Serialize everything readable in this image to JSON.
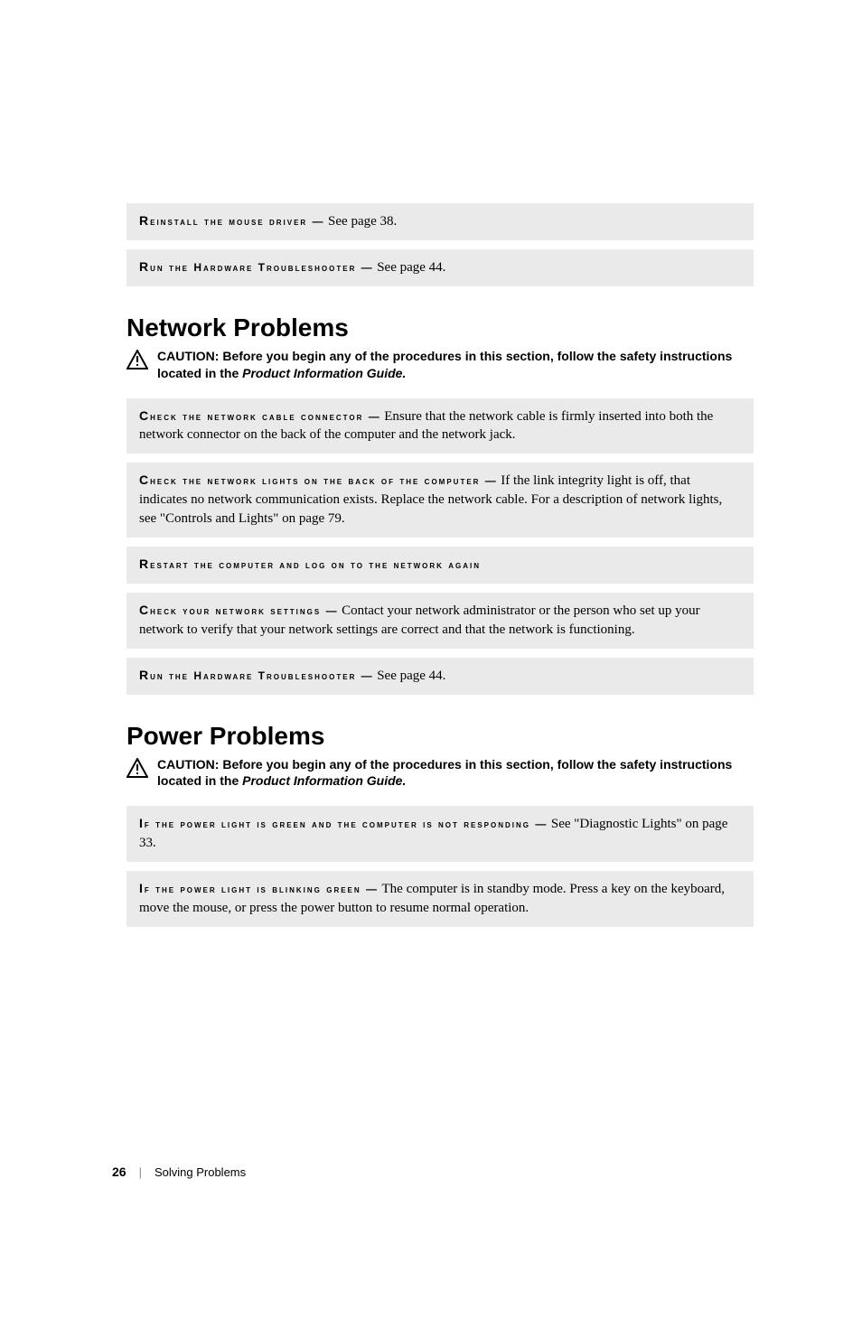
{
  "rows": {
    "r1": {
      "label": "Reinstall the mouse driver —",
      "body": "See page 38."
    },
    "r2": {
      "label": "Run the Hardware Troubleshooter —",
      "body": "See page 44."
    },
    "r3": {
      "label": "Check the network cable connector —",
      "body": "Ensure that the network cable is firmly inserted into both the network connector on the back of the computer and the network jack."
    },
    "r4": {
      "label": "Check the network lights on the back of the computer —",
      "body": "If the link integrity light is off, that indicates no network communication exists. Replace the network cable. For a description of network lights, see \"Controls and Lights\" on page 79."
    },
    "r5": {
      "label": "Restart the computer and log on to the network again",
      "body": ""
    },
    "r6": {
      "label": "Check your network settings —",
      "body": "Contact your network administrator or the person who set up your network to verify that your network settings are correct and that the network is functioning."
    },
    "r7": {
      "label": "Run the Hardware Troubleshooter —",
      "body": "See page 44."
    },
    "r8": {
      "label": "If the power light is green and the computer is not responding —",
      "body": "See \"Diagnostic Lights\" on page 33."
    },
    "r9": {
      "label": "If the power light is blinking green —",
      "body": "The computer is in standby mode. Press a key on the keyboard, move the mouse, or press the power button to resume normal operation."
    }
  },
  "sections": {
    "s1": "Network Problems",
    "s2": "Power Problems"
  },
  "caution": {
    "lead": "CAUTION: ",
    "body": "Before you begin any of the procedures in this section, follow the safety instructions located in the ",
    "pig": "Product Information Guide."
  },
  "footer": {
    "page": "26",
    "sep": "|",
    "chapter": "Solving Problems"
  }
}
